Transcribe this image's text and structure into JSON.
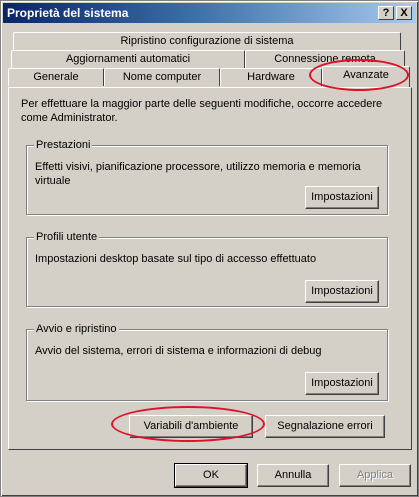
{
  "window": {
    "title": "Proprietà del sistema",
    "help_button": "?",
    "close_button": "X"
  },
  "tabs": {
    "row1": [
      "Ripristino configurazione di sistema"
    ],
    "row2": [
      "Aggiornamenti automatici",
      "Connessione remota"
    ],
    "row3": [
      "Generale",
      "Nome computer",
      "Hardware",
      "Avanzate"
    ],
    "active": "Avanzate"
  },
  "intro_text": "Per effettuare la maggior parte delle seguenti modifiche, occorre accedere come Administrator.",
  "groups": {
    "performance": {
      "label": "Prestazioni",
      "description": "Effetti visivi, pianificazione processore, utilizzo memoria e memoria virtuale",
      "button": "Impostazioni"
    },
    "user_profiles": {
      "label": "Profili utente",
      "description": "Impostazioni desktop basate sul tipo di accesso effettuato",
      "button": "Impostazioni"
    },
    "startup_recovery": {
      "label": "Avvio e ripristino",
      "description": "Avvio del sistema, errori di sistema e informazioni di debug",
      "button": "Impostazioni"
    }
  },
  "bottom_buttons": {
    "env_vars": "Variabili d'ambiente",
    "error_reporting": "Segnalazione errori"
  },
  "dialog_buttons": {
    "ok": "OK",
    "cancel": "Annulla",
    "apply": "Applica"
  },
  "colors": {
    "highlight_ellipse": "#e0102a",
    "titlebar": "#0a246a"
  }
}
